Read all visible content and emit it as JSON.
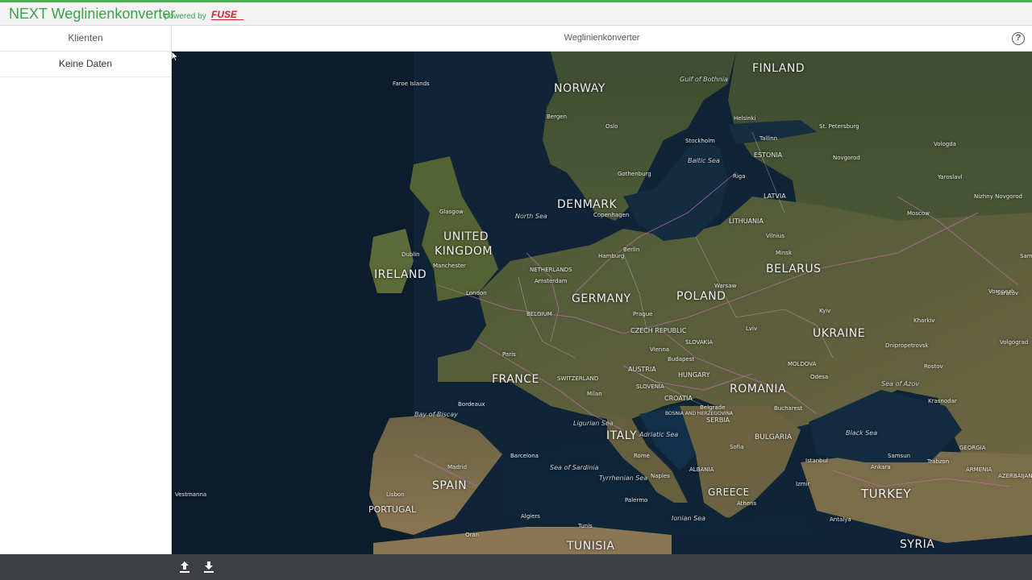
{
  "header": {
    "app_title": "NEXT Weglinienkonverter",
    "powered_by": "powered by",
    "logo_text": "FUSE"
  },
  "sidebar": {
    "title": "Klienten",
    "empty_text": "Keine Daten"
  },
  "main": {
    "title": "Weglinienkonverter"
  },
  "map": {
    "countries": [
      "FINLAND",
      "NORWAY",
      "DENMARK",
      "UNITED",
      "KINGDOM",
      "IRELAND",
      "NETHERLANDS",
      "GERMANY",
      "POLAND",
      "BELARUS",
      "UKRAINE",
      "ESTONIA",
      "LATVIA",
      "LITHUANIA",
      "BELGIUM",
      "CZECH REPUBLIC",
      "SLOVAKIA",
      "AUSTRIA",
      "HUNGARY",
      "ROMANIA",
      "MOLDOVA",
      "SWITZERLAND",
      "FRANCE",
      "SLOVENIA",
      "CROATIA",
      "BOSNIA AND HERZEGOVINA",
      "SERBIA",
      "BULGARIA",
      "ITALY",
      "SPAIN",
      "PORTUGAL",
      "ALBANIA",
      "GREECE",
      "TURKEY",
      "TUNISIA",
      "SYRIA",
      "GEORGIA",
      "ARMENIA",
      "AZERBAIJAN"
    ],
    "seas": [
      "Gulf of Bothnia",
      "Baltic Sea",
      "North Sea",
      "Bay of Biscay",
      "Ligurian Sea",
      "Adriatic Sea",
      "Sea of Sardinia",
      "Tyrrhenian Sea",
      "Ionian Sea",
      "Black Sea",
      "Sea of Azov"
    ],
    "cities": [
      "St. Petersburg",
      "Moscow",
      "Minsk",
      "Warsaw",
      "Kyiv",
      "Berlin",
      "Hamburg",
      "Copenhagen",
      "Stockholm",
      "Oslo",
      "Helsinki",
      "Tallinn",
      "Riga",
      "London",
      "Paris",
      "Bordeaux",
      "Madrid",
      "Barcelona",
      "Lisbon",
      "Rome",
      "Naples",
      "Milan",
      "Vienna",
      "Prague",
      "Budapest",
      "Belgrade",
      "Bucharest",
      "Sofia",
      "Athens",
      "Istanbul",
      "Ankara",
      "Odesa",
      "Dublin",
      "Glasgow",
      "Manchester",
      "Amsterdam",
      "Bergen",
      "Vologda",
      "Yaroslavl",
      "Voronezh",
      "Kharkiv",
      "Dnipropetrovsk",
      "Krasnodar",
      "Rostov",
      "Volgograd",
      "Saratov",
      "Samara",
      "Nizhny Novgorod",
      "Novgorod",
      "Palermo",
      "Algiers",
      "Oran",
      "Tunis",
      "Antalya",
      "Izmir",
      "Trabzon",
      "Samsun",
      "Gothenburg",
      "Vilnius",
      "Lviv",
      "Faroe Islands",
      "Vestmanna"
    ],
    "colors": {
      "ocean": "#0f2436",
      "land_dark": "#4d5834",
      "land_light": "#7a6f4e",
      "roads": "#c96fb0",
      "border": "#d9d9d9"
    }
  },
  "toolbar": {
    "upload_icon": "upload-icon",
    "download_icon": "download-icon"
  }
}
